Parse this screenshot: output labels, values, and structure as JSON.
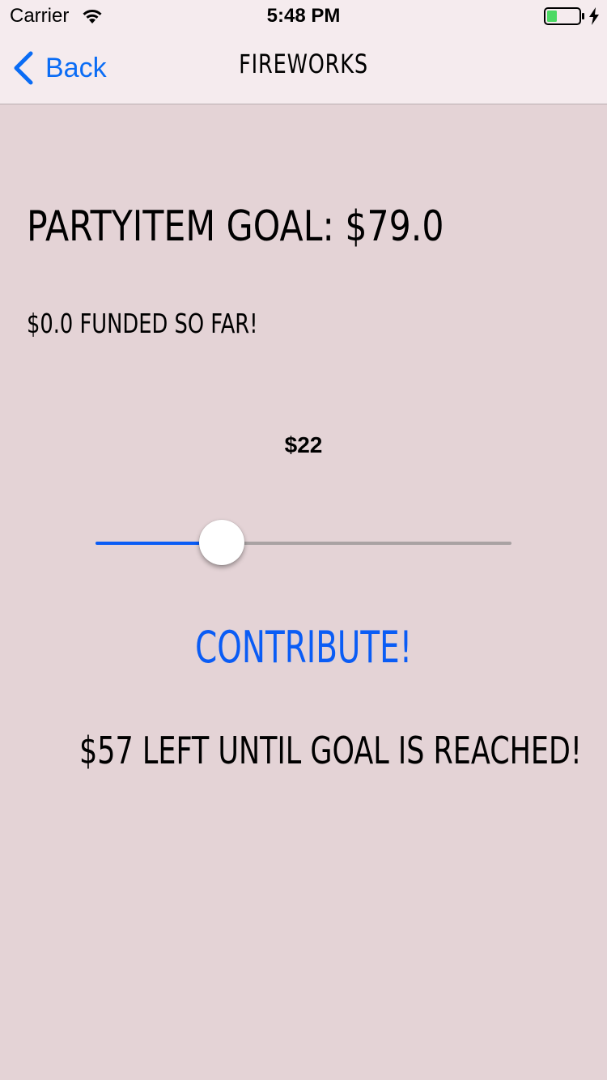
{
  "status_bar": {
    "carrier": "Carrier",
    "time": "5:48 PM",
    "battery_color": "#4cd964"
  },
  "nav": {
    "back_label": "Back",
    "title": "FIREWORKS",
    "accent_color": "#0a6cf5"
  },
  "content": {
    "goal_title": "PARTYITEM GOAL: $79.0",
    "funded_text": "$0.0 FUNDED SO FAR!",
    "slider_value_label": "$22",
    "slider": {
      "value": 22,
      "min": 0,
      "max": 79,
      "min_track_color": "#0a5cf5",
      "max_track_color": "#a9a2a3"
    },
    "contribute_label": "CONTRIBUTE!",
    "remaining_text": "$57 LEFT UNTIL GOAL IS REACHED!"
  }
}
